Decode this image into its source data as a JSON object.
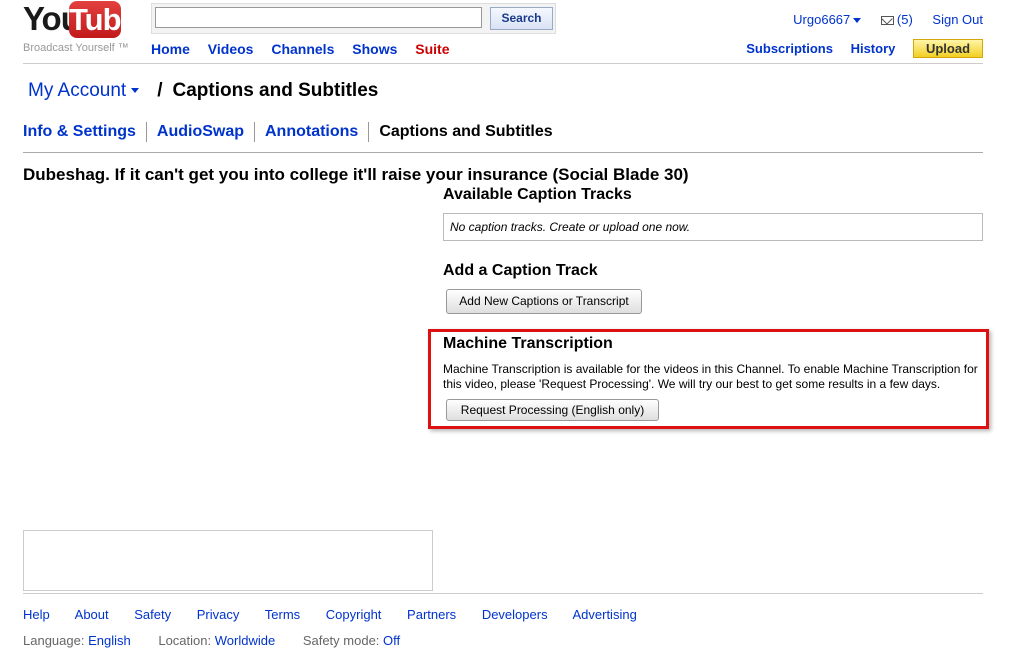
{
  "logo": {
    "you": "You",
    "tube": "Tube",
    "tagline": "Broadcast Yourself ™"
  },
  "search": {
    "button_label": "Search",
    "value": "",
    "placeholder": ""
  },
  "topnav": {
    "home": "Home",
    "videos": "Videos",
    "channels": "Channels",
    "shows": "Shows",
    "suite": "Suite"
  },
  "user": {
    "username": "Urgo6667",
    "mail_count": "(5)",
    "sign_out": "Sign Out"
  },
  "subnav": {
    "subscriptions": "Subscriptions",
    "history": "History",
    "upload": "Upload"
  },
  "breadcrumb": {
    "account": "My Account",
    "separator": "/",
    "page": "Captions and Subtitles"
  },
  "tabs": [
    {
      "label": "Info & Settings"
    },
    {
      "label": "AudioSwap"
    },
    {
      "label": "Annotations"
    },
    {
      "label": "Captions and Subtitles"
    }
  ],
  "video": {
    "title": "Dubeshag. If it can't get you into college it'll raise your insurance (Social Blade 30)"
  },
  "available": {
    "heading": "Available Caption Tracks",
    "empty_text": "No caption tracks. Create or upload one now."
  },
  "add_track": {
    "heading": "Add a Caption Track",
    "button_label": "Add New Captions or Transcript"
  },
  "machine": {
    "heading": "Machine Transcription",
    "text": "Machine Transcription is available for the videos in this Channel. To enable Machine Transcription for this video, please 'Request Processing'. We will try our best to get some results in a few days.",
    "button_label": "Request Processing (English only)",
    "highlight_color": "#dd1111"
  },
  "footer": {
    "links": [
      "Help",
      "About",
      "Safety",
      "Privacy",
      "Terms",
      "Copyright",
      "Partners",
      "Developers",
      "Advertising"
    ],
    "language_label": "Language:",
    "language_value": "English",
    "location_label": "Location:",
    "location_value": "Worldwide",
    "safety_label": "Safety mode:",
    "safety_value": "Off"
  },
  "colors": {
    "link": "#0033cc",
    "suite": "#cc0000",
    "upload_bg": "#f2cf22"
  }
}
